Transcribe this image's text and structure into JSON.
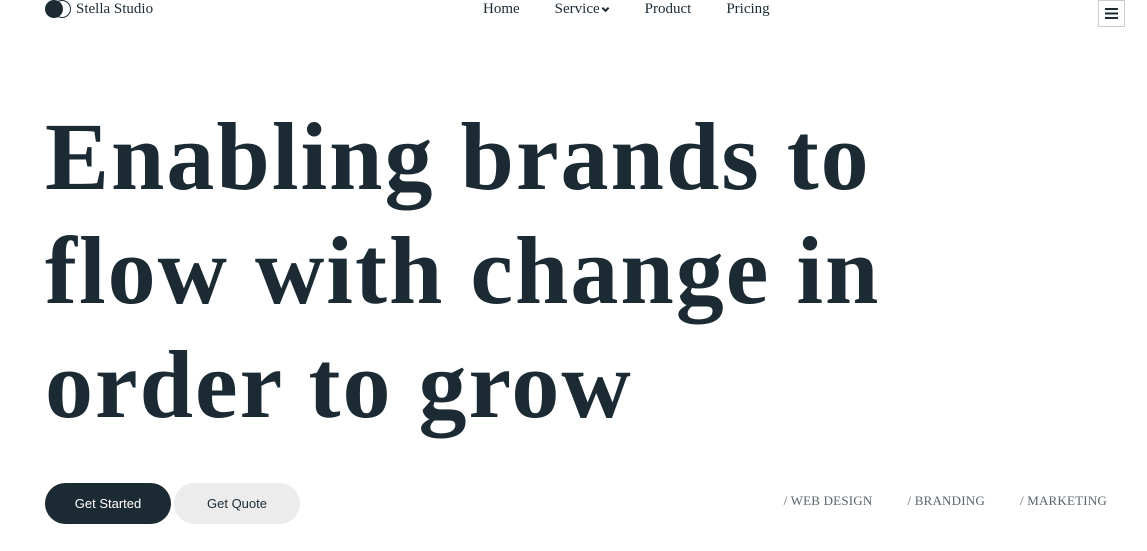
{
  "header": {
    "brand": "Stella Studio",
    "nav": [
      {
        "label": "Home"
      },
      {
        "label": "Service"
      },
      {
        "label": "Product"
      },
      {
        "label": "Pricing"
      }
    ],
    "menu_icon": "hamburger-icon"
  },
  "hero": {
    "title": "Enabling brands to flow with change in order to grow",
    "primary_button": "Get Started",
    "secondary_button": "Get Quote",
    "tags": [
      "/ WEB DESIGN",
      "/ BRANDING",
      "/ MARKETING"
    ]
  },
  "colors": {
    "primary": "#1b2a33",
    "secondary_bg": "#ececec",
    "background": "#ffffff"
  }
}
